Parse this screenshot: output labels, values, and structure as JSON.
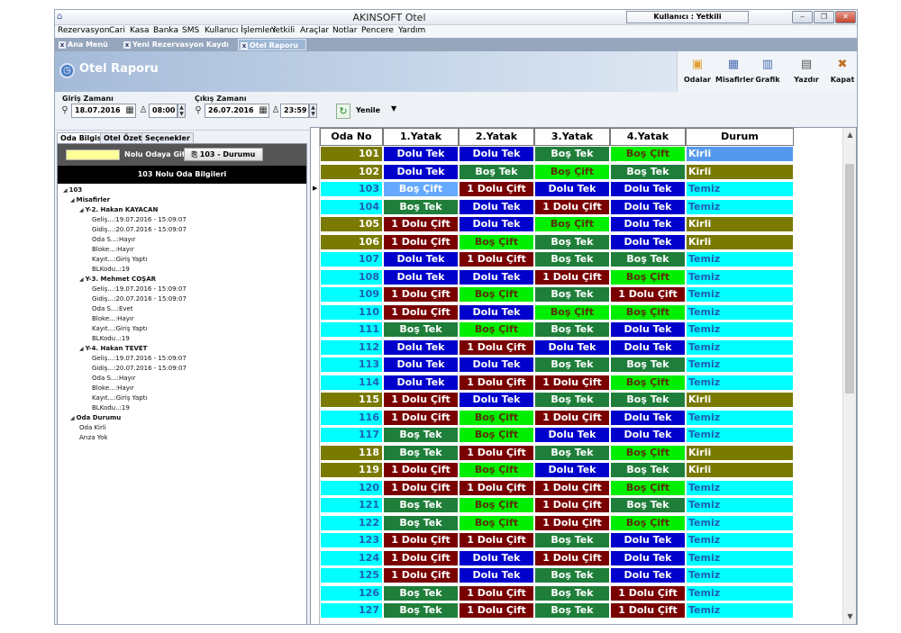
{
  "window": {
    "title": "AKINSOFT Otel",
    "user_label": "Kullanıcı : Yetkili",
    "minimize": "‒",
    "maximize": "❐",
    "close": "✕"
  },
  "menu": [
    "Rezervasyon",
    "Cari",
    "Kasa",
    "Banka",
    "SMS",
    "Kullanıcı İşlemleri",
    "Yetkili",
    "Araçlar",
    "Notlar",
    "Pencere",
    "Yardım"
  ],
  "doc_tabs": [
    "Ana Menü",
    "Yeni Rezervasyon Kaydı",
    "Otel Raporu"
  ],
  "header": {
    "title": "Otel Raporu"
  },
  "toolbar": [
    {
      "label": "Odalar",
      "icon": "rooms-icon",
      "glyph": "▣",
      "color": "#e0a030"
    },
    {
      "label": "Misafirler",
      "icon": "guests-icon",
      "glyph": "▦",
      "color": "#4a6fb5"
    },
    {
      "label": "Grafik",
      "icon": "chart-icon",
      "glyph": "▥",
      "color": "#4a6fb5"
    },
    {
      "label": "Yazdır",
      "icon": "printer-icon",
      "glyph": "▤",
      "color": "#555555"
    },
    {
      "label": "Kapat",
      "icon": "exit-icon",
      "glyph": "✖",
      "color": "#c07020"
    }
  ],
  "dates": {
    "checkin_label": "Giriş Zamanı",
    "checkin_date": "18.07.2016",
    "checkin_time": "08:00",
    "checkout_label": "Çıkış Zamanı",
    "checkout_date": "26.07.2016",
    "checkout_time": "23:59",
    "refresh": "Yenile"
  },
  "left_tabs": [
    "Oda Bilgisi",
    "Otel Özeti",
    "Seçenekler"
  ],
  "room_panel": {
    "goto_label": "Nolu Odaya Git",
    "goto_button": "103 - Durumu",
    "info_title": "103 Nolu Oda Bilgileri"
  },
  "tree": [
    {
      "text": "103",
      "level": 0,
      "bold": true,
      "exp": true
    },
    {
      "text": "Misafirler",
      "level": 1,
      "bold": true,
      "exp": true
    },
    {
      "text": "Y-2. Hakan KAYACAN",
      "level": 2,
      "bold": true,
      "exp": true
    },
    {
      "text": "Geliş...:19.07.2016 - 15:09:07",
      "level": 3
    },
    {
      "text": "Gidiş...:20.07.2016 - 15:09:07",
      "level": 3
    },
    {
      "text": "Oda S...:Hayır",
      "level": 3
    },
    {
      "text": "Bloke...:Hayır",
      "level": 3
    },
    {
      "text": "Kayıt...:Giriş Yaptı",
      "level": 3
    },
    {
      "text": "BLKodu..:19",
      "level": 3
    },
    {
      "text": "Y-3. Mehmet COŞAR",
      "level": 2,
      "bold": true,
      "exp": true
    },
    {
      "text": "Geliş...:19.07.2016 - 15:09:07",
      "level": 3
    },
    {
      "text": "Gidiş...:20.07.2016 - 15:09:07",
      "level": 3
    },
    {
      "text": "Oda S...:Evet",
      "level": 3
    },
    {
      "text": "Bloke...:Hayır",
      "level": 3
    },
    {
      "text": "Kayıt...:Giriş Yaptı",
      "level": 3
    },
    {
      "text": "BLKodu..:19",
      "level": 3
    },
    {
      "text": "Y-4. Hakan TEVET",
      "level": 2,
      "bold": true,
      "exp": true
    },
    {
      "text": "Geliş...:19.07.2016 - 15:09:07",
      "level": 3
    },
    {
      "text": "Gidiş...:20.07.2016 - 15:09:07",
      "level": 3
    },
    {
      "text": "Oda S...:Hayır",
      "level": 3
    },
    {
      "text": "Bloke...:Hayır",
      "level": 3
    },
    {
      "text": "Kayıt...:Giriş Yaptı",
      "level": 3
    },
    {
      "text": "BLKodu..:19",
      "level": 3
    },
    {
      "text": "Oda Durumu",
      "level": 1,
      "bold": true,
      "exp": true
    },
    {
      "text": "Oda Kirli",
      "level": 2
    },
    {
      "text": "Arıza Yok",
      "level": 2
    }
  ],
  "grid": {
    "columns": [
      "Oda No",
      "1.Yatak",
      "2.Yatak",
      "3.Yatak",
      "4.Yatak",
      "Durum"
    ],
    "labels": {
      "D": "Dolu Tek",
      "B": "Boş Tek",
      "G": "Boş Çift",
      "C": "1 Dolu Çift",
      "S": "Boş Çift"
    },
    "status_labels": {
      "T": "Temiz",
      "K": "Kirli"
    },
    "rows": [
      {
        "no": "101",
        "beds": [
          "D",
          "D",
          "B",
          "G"
        ],
        "status": "K",
        "durum_bg": "#5599ee"
      },
      {
        "no": "102",
        "beds": [
          "D",
          "B",
          "G",
          "B"
        ],
        "status": "K"
      },
      {
        "no": "103",
        "beds": [
          "S",
          "C",
          "D",
          "D"
        ],
        "status": "T"
      },
      {
        "no": "104",
        "beds": [
          "B",
          "D",
          "C",
          "D"
        ],
        "status": "T"
      },
      {
        "no": "105",
        "beds": [
          "C",
          "D",
          "G",
          "D"
        ],
        "status": "K"
      },
      {
        "no": "106",
        "beds": [
          "C",
          "G",
          "B",
          "D"
        ],
        "status": "K"
      },
      {
        "no": "107",
        "beds": [
          "D",
          "C",
          "B",
          "B"
        ],
        "status": "T"
      },
      {
        "no": "108",
        "beds": [
          "D",
          "D",
          "C",
          "G"
        ],
        "status": "T"
      },
      {
        "no": "109",
        "beds": [
          "C",
          "G",
          "B",
          "C"
        ],
        "status": "T"
      },
      {
        "no": "110",
        "beds": [
          "C",
          "D",
          "G",
          "G"
        ],
        "status": "T"
      },
      {
        "no": "111",
        "beds": [
          "B",
          "G",
          "B",
          "D"
        ],
        "status": "T"
      },
      {
        "no": "112",
        "beds": [
          "D",
          "C",
          "D",
          "D"
        ],
        "status": "T"
      },
      {
        "no": "113",
        "beds": [
          "D",
          "D",
          "B",
          "B"
        ],
        "status": "T"
      },
      {
        "no": "114",
        "beds": [
          "D",
          "C",
          "C",
          "G"
        ],
        "status": "T"
      },
      {
        "no": "115",
        "beds": [
          "C",
          "D",
          "B",
          "B"
        ],
        "status": "K"
      },
      {
        "no": "116",
        "beds": [
          "C",
          "G",
          "C",
          "D"
        ],
        "status": "T"
      },
      {
        "no": "117",
        "beds": [
          "B",
          "G",
          "D",
          "D"
        ],
        "status": "T"
      },
      {
        "no": "118",
        "beds": [
          "B",
          "C",
          "B",
          "G"
        ],
        "status": "K"
      },
      {
        "no": "119",
        "beds": [
          "C",
          "G",
          "D",
          "B"
        ],
        "status": "K"
      },
      {
        "no": "120",
        "beds": [
          "C",
          "C",
          "C",
          "G"
        ],
        "status": "T"
      },
      {
        "no": "121",
        "beds": [
          "B",
          "G",
          "C",
          "B"
        ],
        "status": "T"
      },
      {
        "no": "122",
        "beds": [
          "B",
          "G",
          "C",
          "G"
        ],
        "status": "T"
      },
      {
        "no": "123",
        "beds": [
          "C",
          "C",
          "B",
          "D"
        ],
        "status": "T"
      },
      {
        "no": "124",
        "beds": [
          "C",
          "D",
          "C",
          "D"
        ],
        "status": "T"
      },
      {
        "no": "125",
        "beds": [
          "C",
          "D",
          "B",
          "D"
        ],
        "status": "T"
      },
      {
        "no": "126",
        "beds": [
          "B",
          "C",
          "B",
          "C"
        ],
        "status": "T"
      },
      {
        "no": "127",
        "beds": [
          "B",
          "C",
          "B",
          "C"
        ],
        "status": "T"
      }
    ]
  }
}
